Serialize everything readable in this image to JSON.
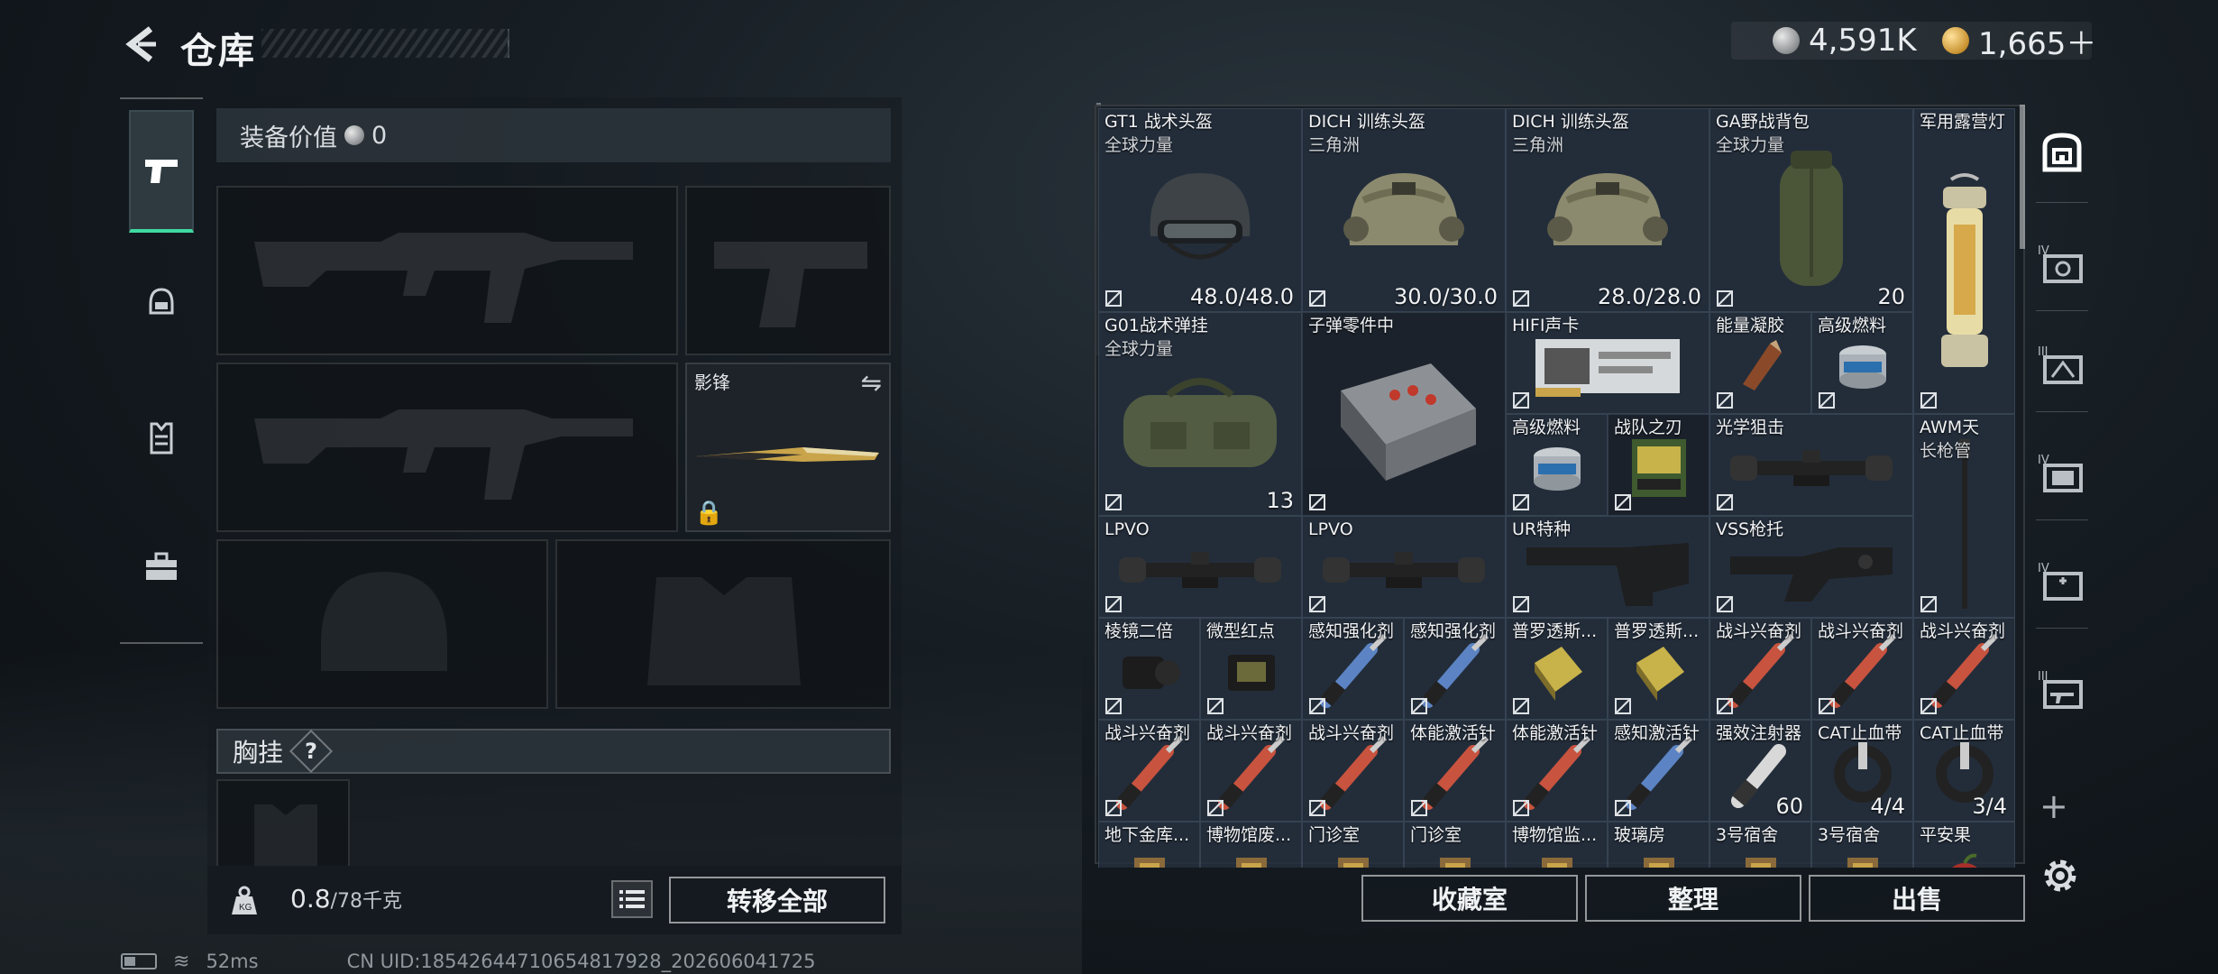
{
  "header": {
    "title": "仓库",
    "silver_amount": "4,591K",
    "gold_amount": "1,665＋"
  },
  "left": {
    "equip_value_label": "装备价值",
    "equip_value": "0",
    "knife_name": "影锋",
    "chest_label": "胸挂",
    "chest_help": "?",
    "weight_value": "0.8",
    "weight_unit": "/78千克",
    "transfer_all": "转移全部"
  },
  "stash": {
    "items": [
      {
        "name": "GT1 战术头盔",
        "sub": "全球力量",
        "val": "48.0/48.0"
      },
      {
        "name": "DICH 训练头盔",
        "sub": "三角洲",
        "val": "30.0/30.0"
      },
      {
        "name": "DICH 训练头盔",
        "sub": "三角洲",
        "val": "28.0/28.0"
      },
      {
        "name": "GA野战背包",
        "sub": "全球力量",
        "val": "20"
      },
      {
        "name": "军用露营灯",
        "sub": "",
        "val": ""
      },
      {
        "name": "G01战术弹挂",
        "sub": "全球力量",
        "val": "13"
      },
      {
        "name": "子弹零件中",
        "sub": "",
        "val": ""
      },
      {
        "name": "HIFI声卡",
        "sub": "",
        "val": ""
      },
      {
        "name": "能量凝胶",
        "sub": "",
        "val": ""
      },
      {
        "name": "高级燃料",
        "sub": "",
        "val": ""
      },
      {
        "name": "高级燃料",
        "sub": "",
        "val": ""
      },
      {
        "name": "战队之刃",
        "sub": "",
        "val": ""
      },
      {
        "name": "光学狙击",
        "sub": "",
        "val": ""
      },
      {
        "name": "AWM天",
        "sub": "长枪管",
        "val": ""
      },
      {
        "name": "LPVO",
        "sub": "",
        "val": ""
      },
      {
        "name": "LPVO",
        "sub": "",
        "val": ""
      },
      {
        "name": "UR特种",
        "sub": "",
        "val": ""
      },
      {
        "name": "VSS枪托",
        "sub": "",
        "val": ""
      },
      {
        "name": "棱镜二倍",
        "sub": "",
        "val": ""
      },
      {
        "name": "微型红点",
        "sub": "",
        "val": ""
      },
      {
        "name": "感知强化剂",
        "sub": "",
        "val": ""
      },
      {
        "name": "感知强化剂",
        "sub": "",
        "val": ""
      },
      {
        "name": "普罗透斯...",
        "sub": "",
        "val": ""
      },
      {
        "name": "普罗透斯...",
        "sub": "",
        "val": ""
      },
      {
        "name": "战斗兴奋剂",
        "sub": "",
        "val": ""
      },
      {
        "name": "战斗兴奋剂",
        "sub": "",
        "val": ""
      },
      {
        "name": "战斗兴奋剂",
        "sub": "",
        "val": ""
      },
      {
        "name": "战斗兴奋剂",
        "sub": "",
        "val": ""
      },
      {
        "name": "战斗兴奋剂",
        "sub": "",
        "val": ""
      },
      {
        "name": "战斗兴奋剂",
        "sub": "",
        "val": ""
      },
      {
        "name": "体能激活针",
        "sub": "",
        "val": ""
      },
      {
        "name": "体能激活针",
        "sub": "",
        "val": ""
      },
      {
        "name": "感知激活针",
        "sub": "",
        "val": ""
      },
      {
        "name": "强效注射器",
        "sub": "",
        "val": "60"
      },
      {
        "name": "CAT止血带",
        "sub": "",
        "val": "4/4"
      },
      {
        "name": "CAT止血带",
        "sub": "",
        "val": "3/4"
      },
      {
        "name": "地下金库...",
        "sub": "",
        "val": ""
      },
      {
        "name": "博物馆废...",
        "sub": "",
        "val": ""
      },
      {
        "name": "门诊室",
        "sub": "",
        "val": ""
      },
      {
        "name": "门诊室",
        "sub": "",
        "val": ""
      },
      {
        "name": "博物馆监...",
        "sub": "",
        "val": ""
      },
      {
        "name": "玻璃房",
        "sub": "",
        "val": ""
      },
      {
        "name": "3号宿舍",
        "sub": "",
        "val": ""
      },
      {
        "name": "3号宿舍",
        "sub": "",
        "val": ""
      },
      {
        "name": "平安果",
        "sub": "",
        "val": ""
      }
    ],
    "buttons": {
      "collection": "收藏室",
      "sort": "整理",
      "sell": "出售"
    }
  },
  "footer": {
    "ping": "52ms",
    "uid": "CN UID:18542644710654817928_202606041725"
  }
}
